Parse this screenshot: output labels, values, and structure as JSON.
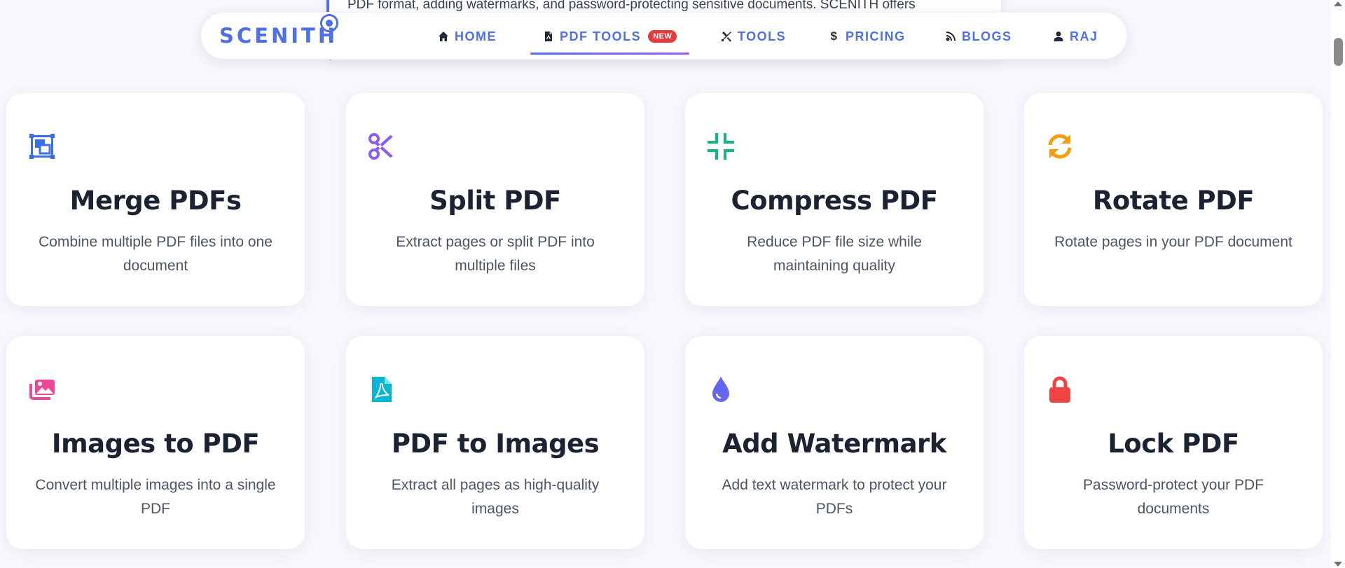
{
  "intro": {
    "text": "PDF format, adding watermarks, and password-protecting sensitive documents. SCENITH offers"
  },
  "navbar": {
    "logo": "SCENITH",
    "items": [
      {
        "label": "HOME",
        "icon": "home-icon"
      },
      {
        "label": "PDF TOOLS",
        "icon": "pdf-file-icon",
        "badge": "NEW",
        "active": true
      },
      {
        "label": "TOOLS",
        "icon": "tools-icon"
      },
      {
        "label": "PRICING",
        "icon": "dollar-icon"
      },
      {
        "label": "BLOGS",
        "icon": "blog-icon"
      },
      {
        "label": "RAJ",
        "icon": "user-icon"
      }
    ]
  },
  "tools": [
    {
      "title": "Merge PDFs",
      "description": "Combine multiple PDF files into one document",
      "icon": "merge-icon",
      "color": "#3b6fe8"
    },
    {
      "title": "Split PDF",
      "description": "Extract pages or split PDF into multiple files",
      "icon": "scissors-icon",
      "color": "#8b5cf6"
    },
    {
      "title": "Compress PDF",
      "description": "Reduce PDF file size while maintaining quality",
      "icon": "compress-icon",
      "color": "#10b981"
    },
    {
      "title": "Rotate PDF",
      "description": "Rotate pages in your PDF document",
      "icon": "rotate-icon",
      "color": "#f59e0b"
    },
    {
      "title": "Images to PDF",
      "description": "Convert multiple images into a single PDF",
      "icon": "images-icon",
      "color": "#ec4899"
    },
    {
      "title": "PDF to Images",
      "description": "Extract all pages as high-quality images",
      "icon": "pdf-file-icon",
      "color": "#06b6d4"
    },
    {
      "title": "Add Watermark",
      "description": "Add text watermark to protect your PDFs",
      "icon": "droplet-icon",
      "color": "#6366f1"
    },
    {
      "title": "Lock PDF",
      "description": "Password-protect your PDF documents",
      "icon": "lock-icon",
      "color": "#ef4444"
    }
  ]
}
